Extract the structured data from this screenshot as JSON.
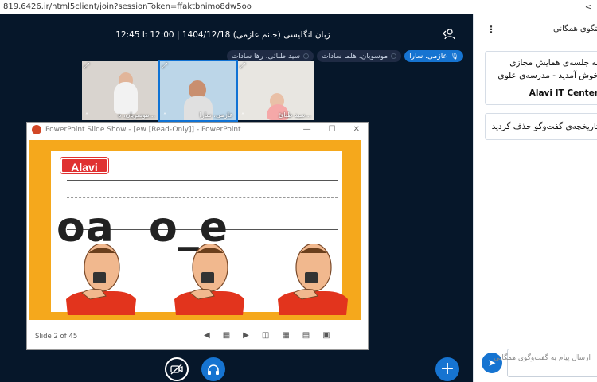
{
  "browser": {
    "url": "819.6426.ir/html5client/join?sessionToken=ffaktbnimo8dw5oo"
  },
  "meeting": {
    "title": "زبان انگلیسی (خانم عازمی) 1404/12/18 | 12:00 تا 12:45"
  },
  "talkers": [
    {
      "label": "عازمی، سارا",
      "state": "active"
    },
    {
      "label": "موسویان، هلما سادات",
      "state": "idle"
    },
    {
      "label": "سید طبائی، رها سادات",
      "state": "idle"
    }
  ],
  "video_tiles": [
    {
      "name": "موسویان، ه...",
      "selected": false
    },
    {
      "name": "عازمی، سارا",
      "selected": true
    },
    {
      "name": "سید طبائ...",
      "selected": false
    }
  ],
  "presentation": {
    "window_title": "PowerPoint Slide Show - [ew [Read-Only]] - PowerPoint",
    "logo_text": "Alavi",
    "word_left": "oa",
    "word_right": "o_e",
    "slide_status": "Slide 2 of 45"
  },
  "chat": {
    "title": "گفتگوی همگانی",
    "welcome_lines": [
      "به جلسه‌ی همایش مجازی",
      "خوش آمدید - مدرسه‌ی علوی",
      "Alavi IT Center"
    ],
    "cleared_notice": "تاریخچه‌ی گفت‌وگو حذف گردید",
    "input_placeholder": "ارسال پیام به گفت‌وگوی همگانی"
  },
  "colors": {
    "stage_bg": "#06172a",
    "accent_blue": "#1674d1",
    "slide_orange": "#f5a81c",
    "logo_red": "#e03131"
  },
  "icons": {
    "user_toggle": "user-icon",
    "share": "share-icon",
    "camera_off": "camera-off-icon",
    "audio": "headphones-icon",
    "actions": "plus-icon",
    "send": "send-icon"
  }
}
